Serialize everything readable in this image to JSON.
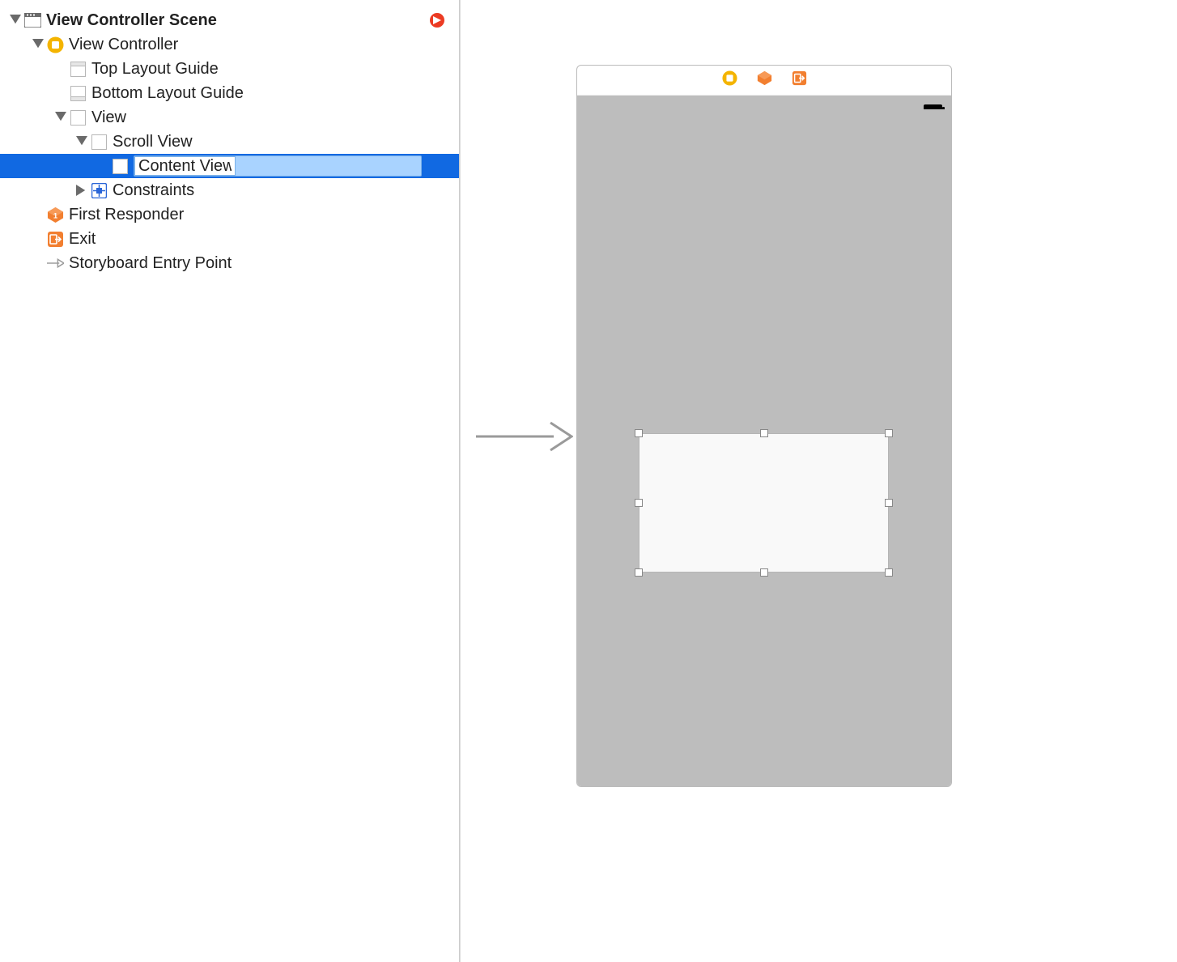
{
  "outline": {
    "scene_label": "View Controller Scene",
    "view_controller": "View Controller",
    "top_layout_guide": "Top Layout Guide",
    "bottom_layout_guide": "Bottom Layout Guide",
    "view": "View",
    "scroll_view": "Scroll View",
    "content_view_value": "Content View",
    "constraints": "Constraints",
    "first_responder": "First Responder",
    "exit": "Exit",
    "storyboard_entry_point": "Storyboard Entry Point"
  },
  "colors": {
    "selection": "#1169e2",
    "orange": "#f27f30",
    "yellow": "#f4b400"
  }
}
